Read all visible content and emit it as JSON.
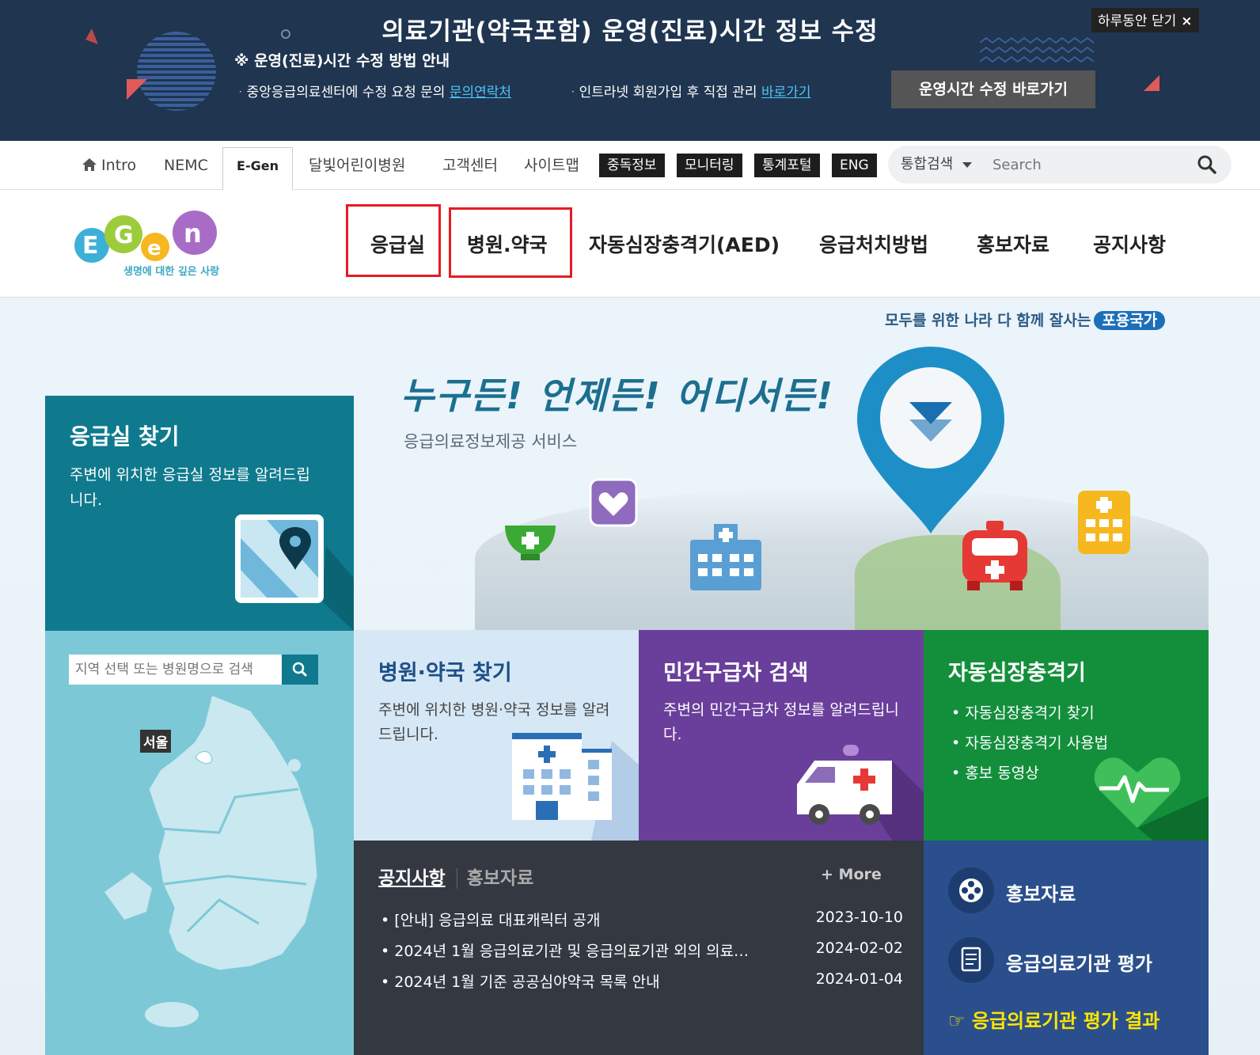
{
  "banner": {
    "title": "의료기관(약국포함) 운영(진료)시간 정보 수정",
    "subtitle": "※ 운영(진료)시간 수정 방법 안내",
    "line1_text": "ᆞ중앙응급의료센터에 수정 요청 문의 ",
    "line1_link": "문의연락처",
    "line2_text": "ᆞ인트라넷 회원가입 후 직접 관리 ",
    "line2_link": "바로가기",
    "button": "운영시간 수정 바로가기",
    "close_label": "하루동안 닫기",
    "close_x": "×"
  },
  "util_nav": {
    "intro": "Intro",
    "nemc": "NEMC",
    "egen": "E-Gen",
    "moonlight": "달빛어린이병원",
    "customer": "고객센터",
    "sitemap": "사이트맵",
    "dark_buttons": [
      "중독정보",
      "모니터링",
      "통계포털",
      "ENG"
    ],
    "search_category": "통합검색",
    "search_placeholder": "Search"
  },
  "logo": {
    "tagline": "생명에 대한 깊은 사랑"
  },
  "main_nav": [
    "응급실",
    "병원.약국",
    "자동심장충격기(AED)",
    "응급처치방법",
    "홍보자료",
    "공지사항"
  ],
  "hero": {
    "tagline_text": "모두를 위한 나라 다 함께 잘사는",
    "tagline_pill": "포용국가",
    "slogan": "누구든! 언제든! 어디서든!",
    "service": "응급의료정보제공 서비스"
  },
  "er_panel": {
    "title": "응급실 찾기",
    "desc": "주변에 위치한 응급실 정보를 알려드립니다."
  },
  "map_panel": {
    "search_placeholder": "지역 선택 또는 병원명으로 검색",
    "seoul": "서울"
  },
  "tiles": {
    "hospital": {
      "title": "병원·약국 찾기",
      "desc": "주변에 위치한 병원·약국 정보를 알려드립니다."
    },
    "ambulance": {
      "title": "민간구급차 검색",
      "desc": "주변의 민간구급차 정보를 알려드립니다."
    },
    "aed": {
      "title": "자동심장충격기",
      "items": [
        "• 자동심장충격기 찾기",
        "• 자동심장충격기 사용법",
        "• 홍보 동영상"
      ]
    }
  },
  "notice": {
    "tab_active": "공지사항",
    "tab_inactive": "홍보자료",
    "more": "+ More",
    "items": [
      {
        "title": "• [안내] 응급의료 대표캐릭터 공개",
        "date": "2023-10-10"
      },
      {
        "title": "• 2024년 1월 응급의료기관 및 응급의료기관 외의 의료…",
        "date": "2024-02-02"
      },
      {
        "title": "• 2024년 1월 기준 공공심야약국 목록 안내",
        "date": "2024-01-04"
      }
    ]
  },
  "promo": {
    "pr": "홍보자료",
    "eval": "응급의료기관 평가",
    "result": "☞ 응급의료기관 평가 결과"
  },
  "colors": {
    "banner_bg": "#1f3550",
    "er_teal": "#0f7a8e",
    "map_bg": "#7dc8d7",
    "purple": "#6a3f9b",
    "green": "#138f3c",
    "promo_blue": "#2a4f8c",
    "highlight_red": "#e51c23",
    "yellow": "#ffe500"
  }
}
